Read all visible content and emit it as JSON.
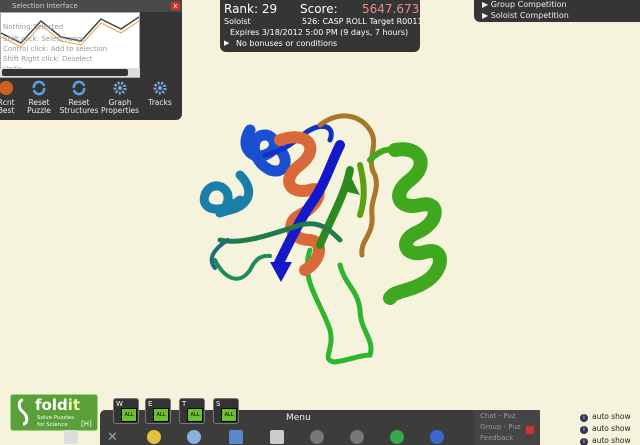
{
  "selection_interface": {
    "title": "Selection Interface",
    "close_label": "x",
    "hints": [
      "Nothing:Selected",
      "Shift click: Select range",
      "Control click: Add to selection",
      "Shift Right click: Deselect",
      "Undo"
    ],
    "tools": [
      {
        "label1": "Rcnt",
        "label2": "Best"
      },
      {
        "label1": "Reset",
        "label2": "Puzzle"
      },
      {
        "label1": "Reset",
        "label2": "Structures"
      },
      {
        "label1": "Graph",
        "label2": "Properties"
      },
      {
        "label1": "Tracks",
        "label2": ""
      }
    ]
  },
  "rank_panel": {
    "rank_label": "Rank: 29",
    "score_label": "Score:",
    "score_value": "5647.673",
    "mode": "Soloist",
    "puzzle": "526: CASP ROLL Target R0011",
    "expires": "Expires 3/18/2012 5:00 PM (9 days, 7 hours)",
    "conditions": "No bonuses or conditions"
  },
  "competition": {
    "items": [
      "Group Competition",
      "Soloist Competition"
    ]
  },
  "logo": {
    "name": "fold",
    "name_accent": "it",
    "tagline1": "Solve Puzzles",
    "tagline2": "for Science",
    "hotkey": "[H]"
  },
  "modes": [
    {
      "key": "W",
      "badge": "ALL"
    },
    {
      "key": "E",
      "badge": "ALL"
    },
    {
      "key": "T",
      "badge": "ALL"
    },
    {
      "key": "S",
      "badge": "ALL"
    }
  ],
  "menu": {
    "label": "Menu"
  },
  "chat": {
    "rows": [
      "Chat - Puz",
      "Group - Puz",
      "Feedback"
    ]
  },
  "auto_show": {
    "label": "auto show",
    "rows": 3
  },
  "colors": {
    "score": "#e89090",
    "accent": "#6cbf2e",
    "panel": "#262626",
    "background": "#f5f3dc"
  }
}
